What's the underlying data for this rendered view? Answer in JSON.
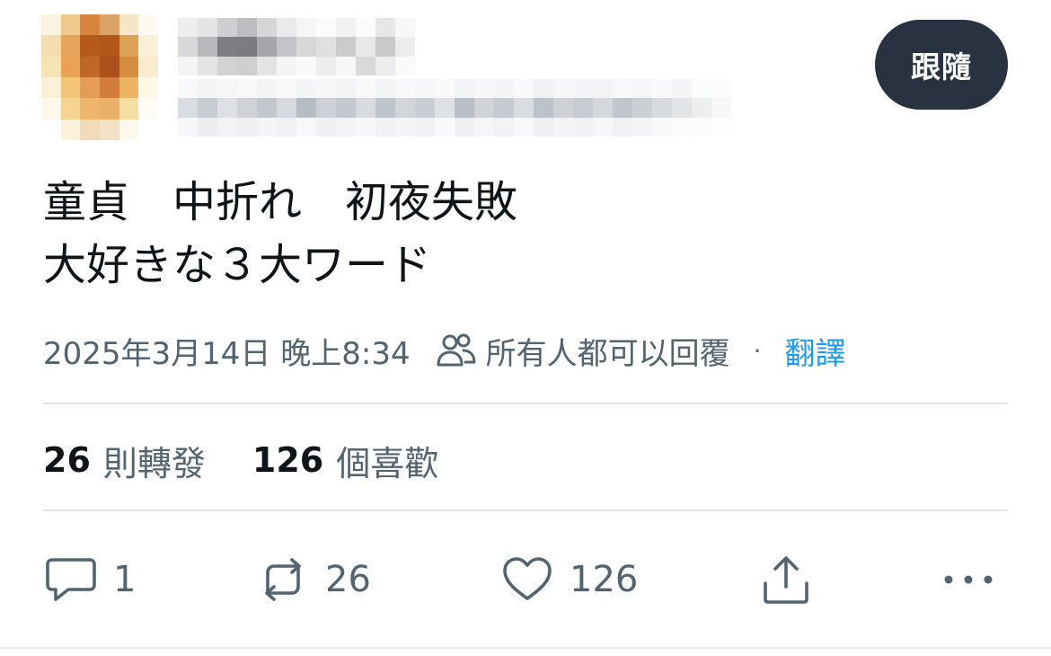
{
  "header": {
    "follow_label": "跟隨"
  },
  "tweet": {
    "text_line1": "童貞　中折れ　初夜失敗",
    "text_line2": "大好きな３大ワード"
  },
  "meta": {
    "date": "2025年3月14日 晚上8:34",
    "audience": "所有人都可以回覆",
    "separator": "·",
    "translate": "翻譯"
  },
  "stats": {
    "retweets_count": "26",
    "retweets_label": "則轉發",
    "likes_count": "126",
    "likes_label": "個喜歡"
  },
  "actions": {
    "reply_count": "1",
    "retweet_count": "26",
    "like_count": "126"
  },
  "colors": {
    "follow_bg": "#283240",
    "secondary_text": "#536471",
    "link": "#1d9bf0",
    "divider": "#e1e6ea"
  },
  "icons": [
    "avatar",
    "people-icon",
    "reply-icon",
    "retweet-icon",
    "heart-icon",
    "share-icon",
    "more-icon"
  ]
}
